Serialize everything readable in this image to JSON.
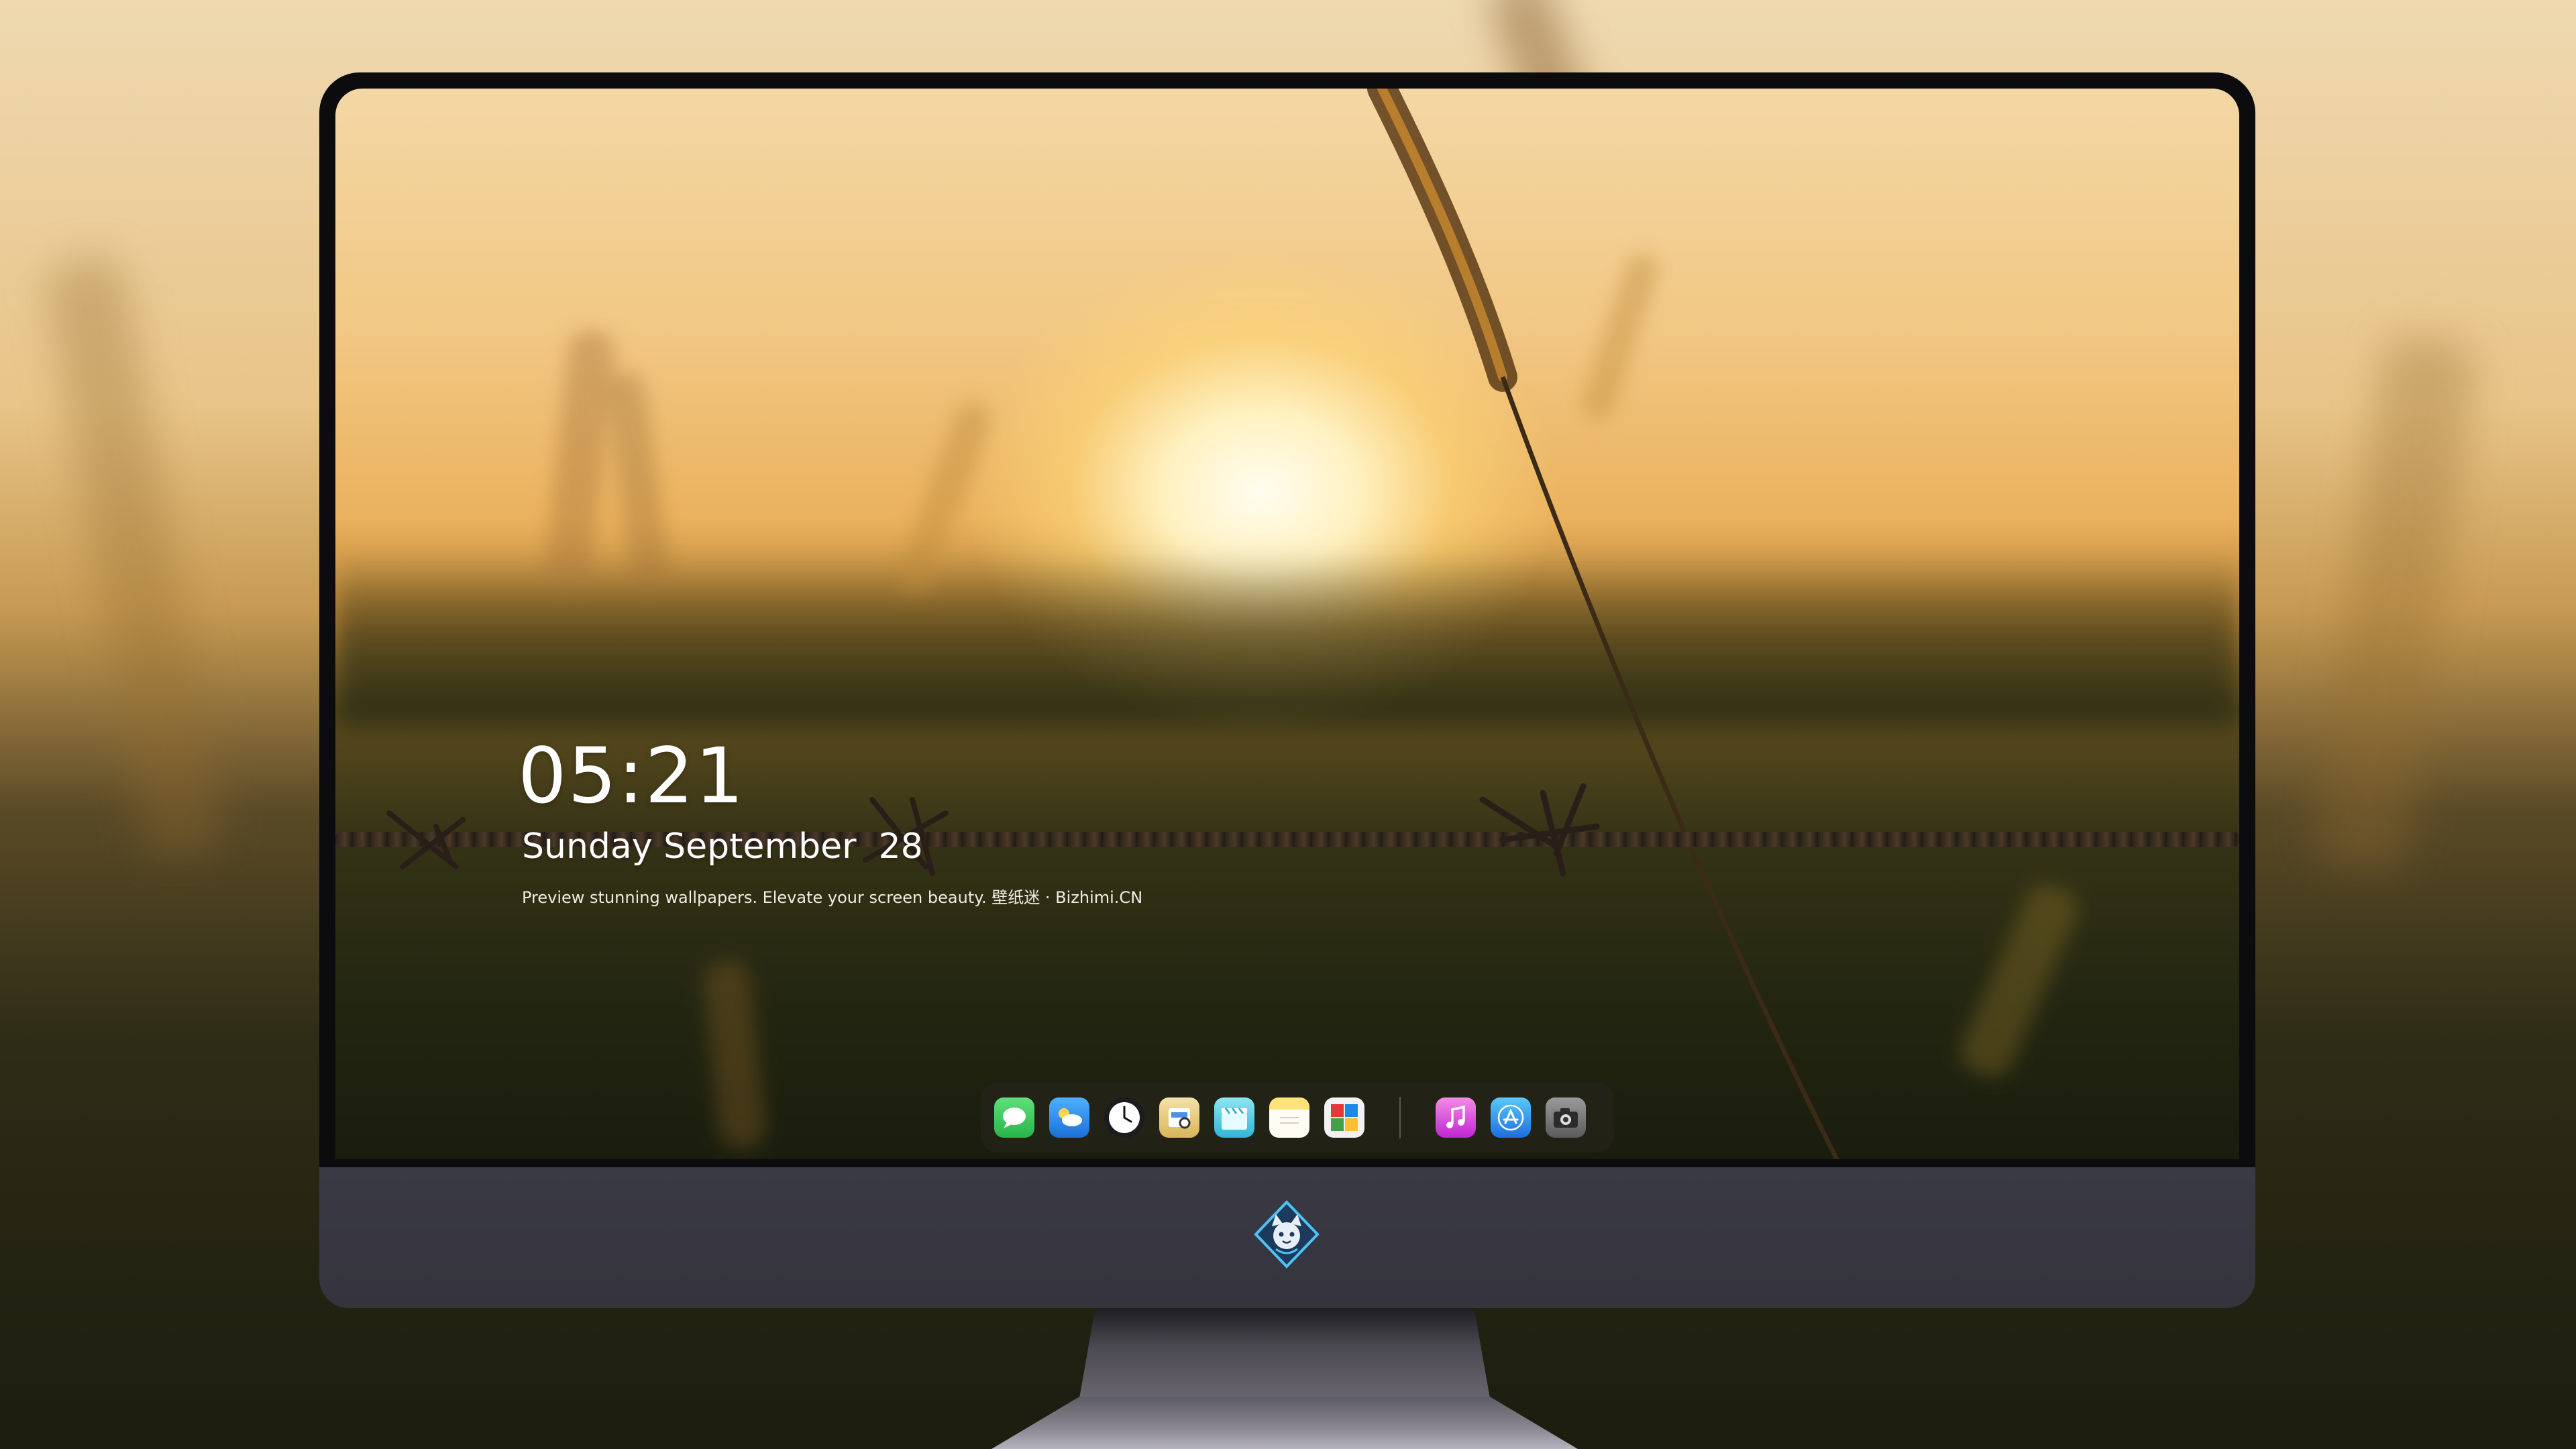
{
  "lock_screen": {
    "time": "05:21",
    "date": "Sunday September  28",
    "caption": "Preview stunning wallpapers. Elevate your screen beauty. 壁纸迷 · Bizhimi.CN"
  },
  "dock": {
    "apps": [
      {
        "icon": "messages-icon",
        "color": "#34c759"
      },
      {
        "icon": "weather-icon",
        "color": "#1e88e5"
      },
      {
        "icon": "clock-icon",
        "color": "#1c1c1e"
      },
      {
        "icon": "preview-icon",
        "color": "#e9c46a"
      },
      {
        "icon": "clapperboard-icon",
        "color": "#3ec1e0"
      },
      {
        "icon": "notes-icon",
        "color": "#ffd54f"
      },
      {
        "icon": "photo-booth-icon",
        "color": "#43a047"
      },
      {
        "icon": "music-icon",
        "color": "#d946ef"
      },
      {
        "icon": "app-store-icon",
        "color": "#1e88e5"
      },
      {
        "icon": "camera-icon",
        "color": "#6b6b6b"
      }
    ]
  },
  "monitor": {
    "logo_icon": "fox-mascot-icon"
  }
}
